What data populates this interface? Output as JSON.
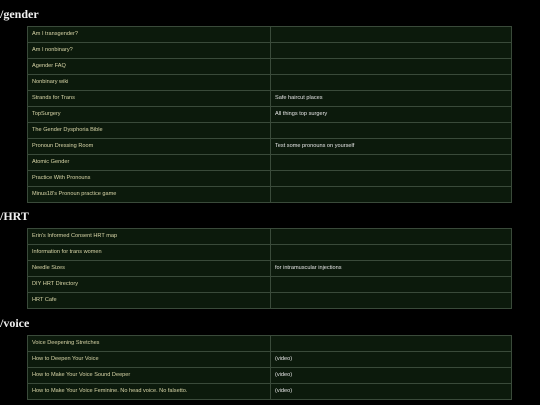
{
  "sections": [
    {
      "heading": "/gender",
      "rows": [
        {
          "link": "Am I transgender?",
          "note": ""
        },
        {
          "link": "Am I nonbinary?",
          "note": ""
        },
        {
          "link": "Agender FAQ",
          "note": ""
        },
        {
          "link": "Nonbinary wiki",
          "note": ""
        },
        {
          "link": "Strands for Trans",
          "note": "Safe haircut places"
        },
        {
          "link": "TopSurgery",
          "note": "All things top surgery"
        },
        {
          "link": "The Gender Dysphoria Bible",
          "note": ""
        },
        {
          "link": "Pronoun Dressing Room",
          "note": "Test some pronouns on yourself"
        },
        {
          "link": "Atomic Gender",
          "note": ""
        },
        {
          "link": "Practice With Pronouns",
          "note": ""
        },
        {
          "link": "Minus18's Pronoun practice game",
          "note": ""
        }
      ]
    },
    {
      "heading": "/HRT",
      "rows": [
        {
          "link": "Erin's Informed Consent HRT map",
          "note": ""
        },
        {
          "link": "Information for trans women",
          "note": ""
        },
        {
          "link": "Needle Sizes",
          "note": "for intramuscular injections"
        },
        {
          "link": "DIY HRT Directory",
          "note": ""
        },
        {
          "link": "HRT Cafe",
          "note": ""
        }
      ]
    },
    {
      "heading": "/voice",
      "rows": [
        {
          "link": "Voice Deepening Stretches",
          "note": ""
        },
        {
          "link": "How to Deepen Your Voice",
          "note": "(video)"
        },
        {
          "link": "How to Make Your Voice Sound Deeper",
          "note": "(video)"
        },
        {
          "link": "How to Make Your Voice Feminine. No head voice. No falsetto.",
          "note": "(video)"
        }
      ]
    }
  ]
}
